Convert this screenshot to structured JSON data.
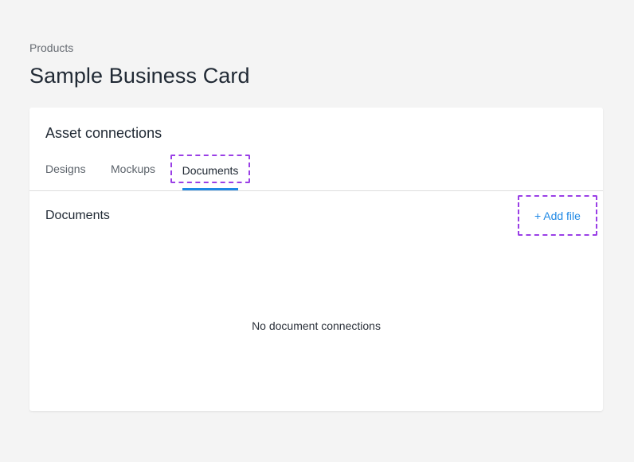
{
  "breadcrumb": {
    "label": "Products"
  },
  "page": {
    "title": "Sample Business Card"
  },
  "asset_connections": {
    "title": "Asset connections",
    "tabs": [
      {
        "label": "Designs",
        "active": false
      },
      {
        "label": "Mockups",
        "active": false
      },
      {
        "label": "Documents",
        "active": true
      }
    ]
  },
  "documents_panel": {
    "title": "Documents",
    "add_button": {
      "icon": "plus-icon",
      "icon_glyph": "+",
      "label": "Add file"
    },
    "empty_message": "No document connections"
  },
  "colors": {
    "accent": "#1e88e5",
    "highlight_outline": "#9a3fe6",
    "text_primary": "#212a35",
    "text_secondary": "#5c636b",
    "background": "#f4f4f4",
    "card": "#ffffff"
  }
}
